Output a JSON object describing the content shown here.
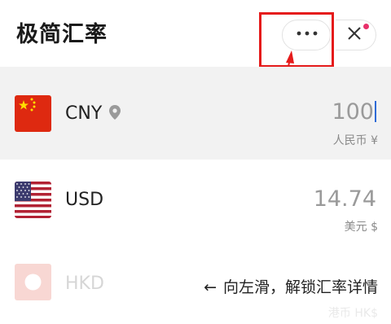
{
  "app": {
    "title": "极简汇率"
  },
  "header": {
    "more_icon": "more-horizontal-icon",
    "close_icon": "close-x-icon",
    "badge_color": "#e8306a"
  },
  "annotation": {
    "box_color": "#e51b1b"
  },
  "rows": [
    {
      "code": "CNY",
      "value": "100",
      "unit": "人民币 ¥",
      "flag": "china-flag",
      "location_icon": "location-pin-icon",
      "highlighted": true
    },
    {
      "code": "USD",
      "value": "14.74",
      "unit": "美元 $",
      "flag": "usa-flag"
    },
    {
      "code": "HKD",
      "value": "",
      "unit": "港币 HK$",
      "flag": "hong-kong-flag",
      "faded": true
    }
  ],
  "swipe_hint": {
    "arrow": "←",
    "text": "向左滑，解锁汇率详情"
  }
}
